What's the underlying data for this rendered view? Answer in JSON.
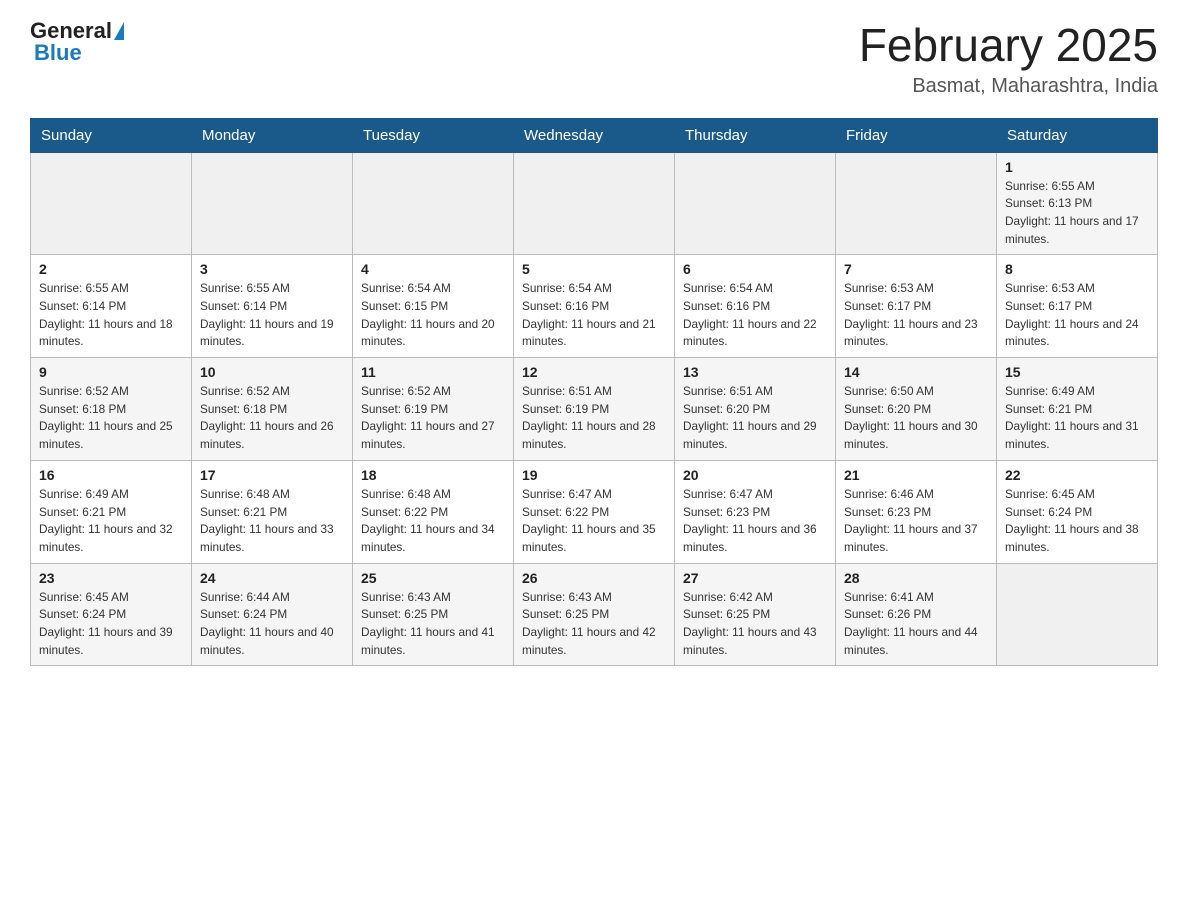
{
  "header": {
    "logo": {
      "general": "General",
      "blue": "Blue"
    },
    "title": "February 2025",
    "location": "Basmat, Maharashtra, India"
  },
  "days_of_week": [
    "Sunday",
    "Monday",
    "Tuesday",
    "Wednesday",
    "Thursday",
    "Friday",
    "Saturday"
  ],
  "weeks": [
    {
      "cells": [
        {
          "empty": true
        },
        {
          "empty": true
        },
        {
          "empty": true
        },
        {
          "empty": true
        },
        {
          "empty": true
        },
        {
          "empty": true
        },
        {
          "day": 1,
          "sunrise": "6:55 AM",
          "sunset": "6:13 PM",
          "daylight": "11 hours and 17 minutes."
        }
      ]
    },
    {
      "cells": [
        {
          "day": 2,
          "sunrise": "6:55 AM",
          "sunset": "6:14 PM",
          "daylight": "11 hours and 18 minutes."
        },
        {
          "day": 3,
          "sunrise": "6:55 AM",
          "sunset": "6:14 PM",
          "daylight": "11 hours and 19 minutes."
        },
        {
          "day": 4,
          "sunrise": "6:54 AM",
          "sunset": "6:15 PM",
          "daylight": "11 hours and 20 minutes."
        },
        {
          "day": 5,
          "sunrise": "6:54 AM",
          "sunset": "6:16 PM",
          "daylight": "11 hours and 21 minutes."
        },
        {
          "day": 6,
          "sunrise": "6:54 AM",
          "sunset": "6:16 PM",
          "daylight": "11 hours and 22 minutes."
        },
        {
          "day": 7,
          "sunrise": "6:53 AM",
          "sunset": "6:17 PM",
          "daylight": "11 hours and 23 minutes."
        },
        {
          "day": 8,
          "sunrise": "6:53 AM",
          "sunset": "6:17 PM",
          "daylight": "11 hours and 24 minutes."
        }
      ]
    },
    {
      "cells": [
        {
          "day": 9,
          "sunrise": "6:52 AM",
          "sunset": "6:18 PM",
          "daylight": "11 hours and 25 minutes."
        },
        {
          "day": 10,
          "sunrise": "6:52 AM",
          "sunset": "6:18 PM",
          "daylight": "11 hours and 26 minutes."
        },
        {
          "day": 11,
          "sunrise": "6:52 AM",
          "sunset": "6:19 PM",
          "daylight": "11 hours and 27 minutes."
        },
        {
          "day": 12,
          "sunrise": "6:51 AM",
          "sunset": "6:19 PM",
          "daylight": "11 hours and 28 minutes."
        },
        {
          "day": 13,
          "sunrise": "6:51 AM",
          "sunset": "6:20 PM",
          "daylight": "11 hours and 29 minutes."
        },
        {
          "day": 14,
          "sunrise": "6:50 AM",
          "sunset": "6:20 PM",
          "daylight": "11 hours and 30 minutes."
        },
        {
          "day": 15,
          "sunrise": "6:49 AM",
          "sunset": "6:21 PM",
          "daylight": "11 hours and 31 minutes."
        }
      ]
    },
    {
      "cells": [
        {
          "day": 16,
          "sunrise": "6:49 AM",
          "sunset": "6:21 PM",
          "daylight": "11 hours and 32 minutes."
        },
        {
          "day": 17,
          "sunrise": "6:48 AM",
          "sunset": "6:21 PM",
          "daylight": "11 hours and 33 minutes."
        },
        {
          "day": 18,
          "sunrise": "6:48 AM",
          "sunset": "6:22 PM",
          "daylight": "11 hours and 34 minutes."
        },
        {
          "day": 19,
          "sunrise": "6:47 AM",
          "sunset": "6:22 PM",
          "daylight": "11 hours and 35 minutes."
        },
        {
          "day": 20,
          "sunrise": "6:47 AM",
          "sunset": "6:23 PM",
          "daylight": "11 hours and 36 minutes."
        },
        {
          "day": 21,
          "sunrise": "6:46 AM",
          "sunset": "6:23 PM",
          "daylight": "11 hours and 37 minutes."
        },
        {
          "day": 22,
          "sunrise": "6:45 AM",
          "sunset": "6:24 PM",
          "daylight": "11 hours and 38 minutes."
        }
      ]
    },
    {
      "cells": [
        {
          "day": 23,
          "sunrise": "6:45 AM",
          "sunset": "6:24 PM",
          "daylight": "11 hours and 39 minutes."
        },
        {
          "day": 24,
          "sunrise": "6:44 AM",
          "sunset": "6:24 PM",
          "daylight": "11 hours and 40 minutes."
        },
        {
          "day": 25,
          "sunrise": "6:43 AM",
          "sunset": "6:25 PM",
          "daylight": "11 hours and 41 minutes."
        },
        {
          "day": 26,
          "sunrise": "6:43 AM",
          "sunset": "6:25 PM",
          "daylight": "11 hours and 42 minutes."
        },
        {
          "day": 27,
          "sunrise": "6:42 AM",
          "sunset": "6:25 PM",
          "daylight": "11 hours and 43 minutes."
        },
        {
          "day": 28,
          "sunrise": "6:41 AM",
          "sunset": "6:26 PM",
          "daylight": "11 hours and 44 minutes."
        },
        {
          "empty": true
        }
      ]
    }
  ]
}
